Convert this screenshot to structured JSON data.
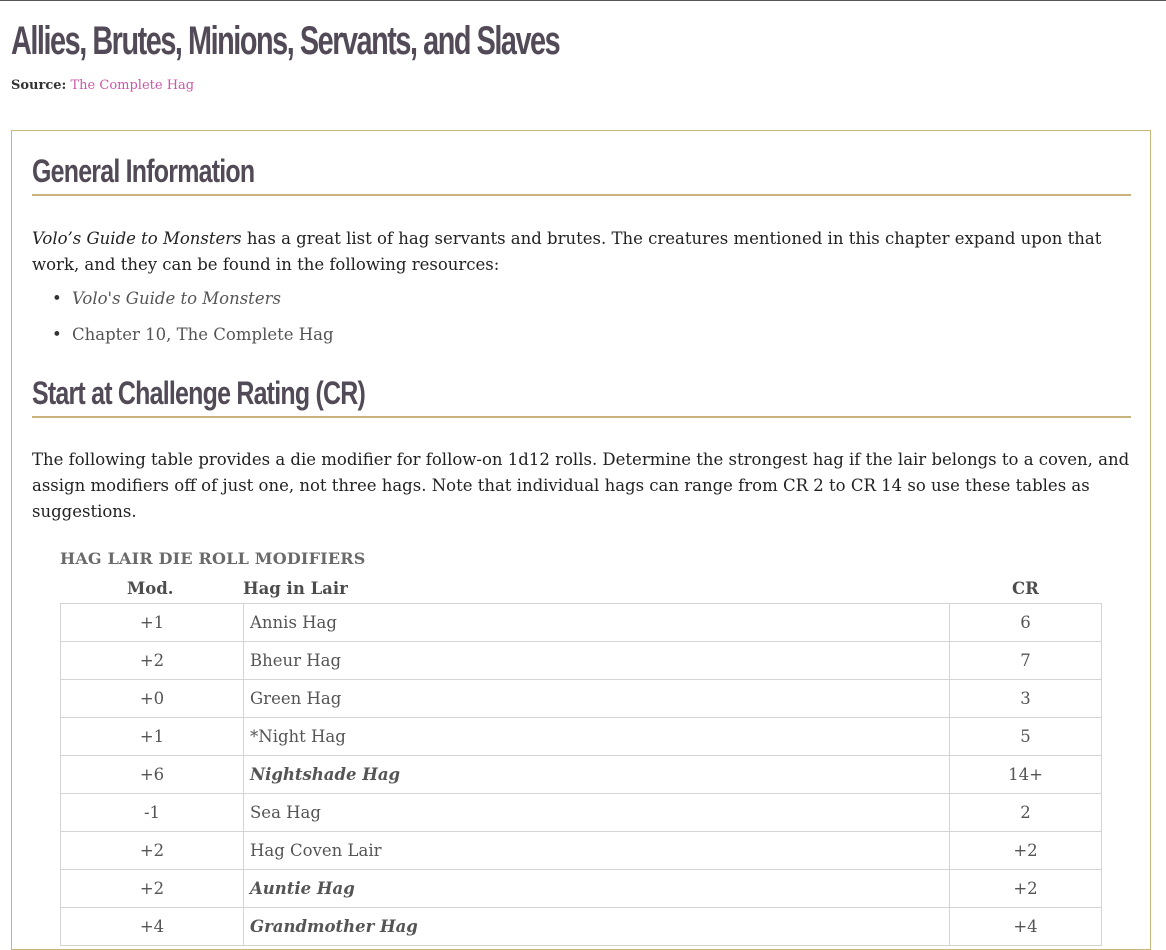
{
  "page_title": "Allies, Brutes, Minions, Servants, and Slaves",
  "source": {
    "label": "Source:",
    "link_text": "The Complete Hag"
  },
  "section1": {
    "heading": "General Information",
    "intro_italic": "Volo’s Guide to Monsters",
    "intro_rest": " has a great list of hag servants and brutes. The creatures mentioned in this chapter expand upon that work, and they can be found in the following resources:",
    "list": [
      "Volo's Guide to Monsters",
      "Chapter 10, The Complete Hag"
    ]
  },
  "section2": {
    "heading": "Start at Challenge Rating (CR)",
    "paragraph": "The following table provides a die modifier for follow-on 1d12 rolls. Determine the strongest hag if the lair belongs to a coven, and assign modifiers off of just one, not three hags. Note that individual hags can range from CR 2 to CR 14 so use these tables as suggestions."
  },
  "table": {
    "caption": "HAG LAIR DIE ROLL MODIFIERS",
    "headers": {
      "mod": "Mod.",
      "hag": "Hag in Lair",
      "cr": "CR"
    },
    "rows": [
      {
        "mod": "+1",
        "hag": "Annis Hag",
        "cr": "6",
        "emph": false
      },
      {
        "mod": "+2",
        "hag": "Bheur Hag",
        "cr": "7",
        "emph": false
      },
      {
        "mod": "+0",
        "hag": "Green Hag",
        "cr": "3",
        "emph": false
      },
      {
        "mod": "+1",
        "hag": "*Night Hag",
        "cr": "5",
        "emph": false
      },
      {
        "mod": "+6",
        "hag": "Nightshade Hag",
        "cr": "14+",
        "emph": true
      },
      {
        "mod": "-1",
        "hag": "Sea Hag",
        "cr": "2",
        "emph": false
      },
      {
        "mod": "+2",
        "hag": "Hag Coven Lair",
        "cr": "+2",
        "emph": false
      },
      {
        "mod": "+2",
        "hag": "Auntie Hag",
        "cr": "+2",
        "emph": true
      },
      {
        "mod": "+4",
        "hag": "Grandmother Hag",
        "cr": "+4",
        "emph": true
      }
    ]
  }
}
